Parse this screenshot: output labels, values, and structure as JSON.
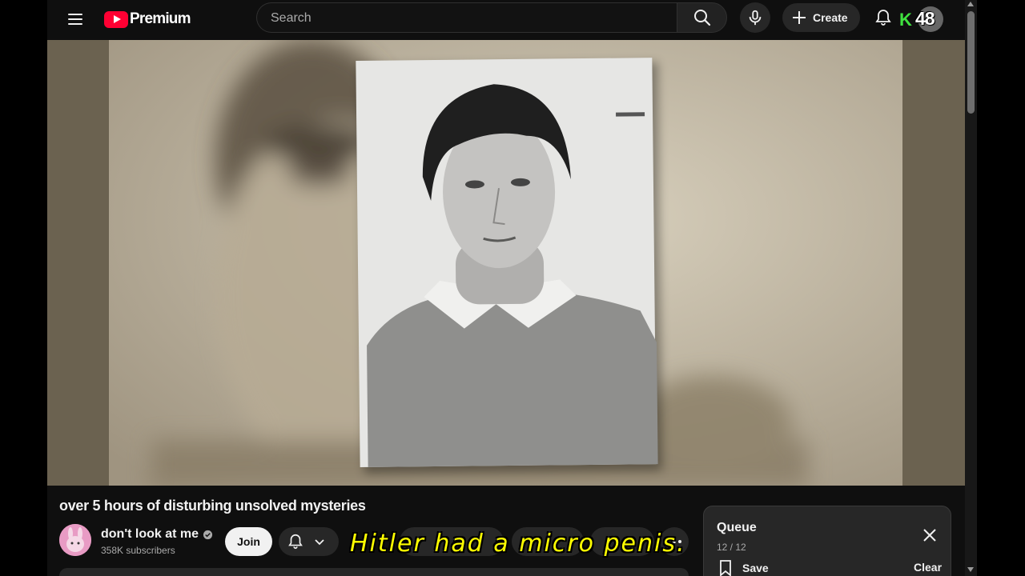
{
  "header": {
    "logo_text": "Premium",
    "search_placeholder": "Search",
    "create_label": "Create",
    "k_badge": "K",
    "counter_badge": "48"
  },
  "video": {
    "title": "over 5 hours of disturbing unsolved mysteries",
    "caption": "Hitler had a micro penis."
  },
  "channel": {
    "name": "don't look at me",
    "subscribers": "358K subscribers",
    "join_label": "Join"
  },
  "queue": {
    "title": "Queue",
    "count": "12 / 12",
    "save_label": "Save",
    "clear_label": "Clear"
  },
  "colors": {
    "background": "#0f0f0f",
    "brand_red": "#ff0033",
    "caption_yellow": "#ffff00",
    "chip": "#272727"
  },
  "icons": [
    "menu-icon",
    "youtube-logo-icon",
    "search-icon",
    "mic-icon",
    "plus-icon",
    "bell-icon",
    "verified-icon",
    "chevron-down-icon",
    "more-icon",
    "close-icon",
    "bookmark-icon"
  ]
}
